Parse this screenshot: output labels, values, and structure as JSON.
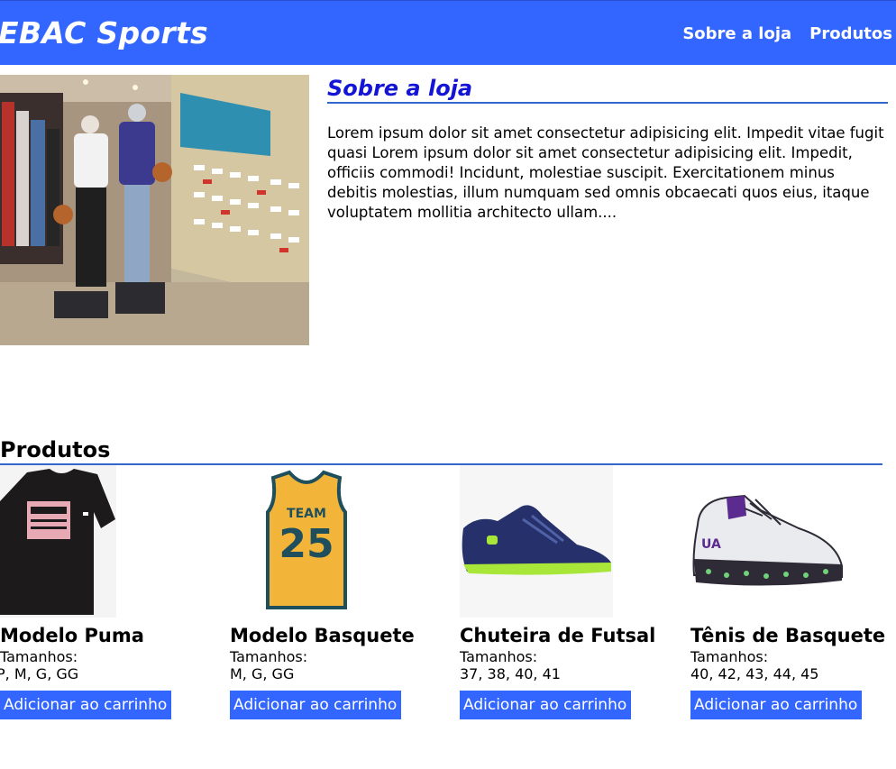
{
  "header": {
    "brand": "EBAC Sports",
    "nav": [
      {
        "label": "Sobre a loja"
      },
      {
        "label": "Produtos"
      }
    ]
  },
  "about": {
    "title": "Sobre a loja",
    "text": "Lorem ipsum dolor sit amet consectetur adipisicing elit. Impedit vitae fugit quasi Lorem ipsum dolor sit amet consectetur adipisicing elit. Impedit, officiis commodi! Incidunt, molestiae suscipit. Exercitationem minus debitis molestias, illum numquam sed omnis obcaecati quos eius, itaque voluptatem mollitia architecto ullam...."
  },
  "products": {
    "title": "Produtos",
    "items": [
      {
        "name": "Modelo Puma",
        "sizes_label": "Tamanhos:",
        "sizes": "P, M, G, GG",
        "button": "Adicionar ao carrinho"
      },
      {
        "name": "Modelo Basquete",
        "sizes_label": "Tamanhos:",
        "sizes": "M, G, GG",
        "button": "Adicionar ao carrinho"
      },
      {
        "name": "Chuteira de Futsal",
        "sizes_label": "Tamanhos:",
        "sizes": "37, 38, 40, 41",
        "button": "Adicionar ao carrinho"
      },
      {
        "name": "Tênis de Basquete",
        "sizes_label": "Tamanhos:",
        "sizes": "40, 42, 43, 44, 45",
        "button": "Adicionar ao carrinho"
      }
    ],
    "jersey_print": {
      "team": "TEAM",
      "number": "25"
    }
  },
  "colors": {
    "accent": "#3366ff",
    "about_title": "#1414d6"
  }
}
